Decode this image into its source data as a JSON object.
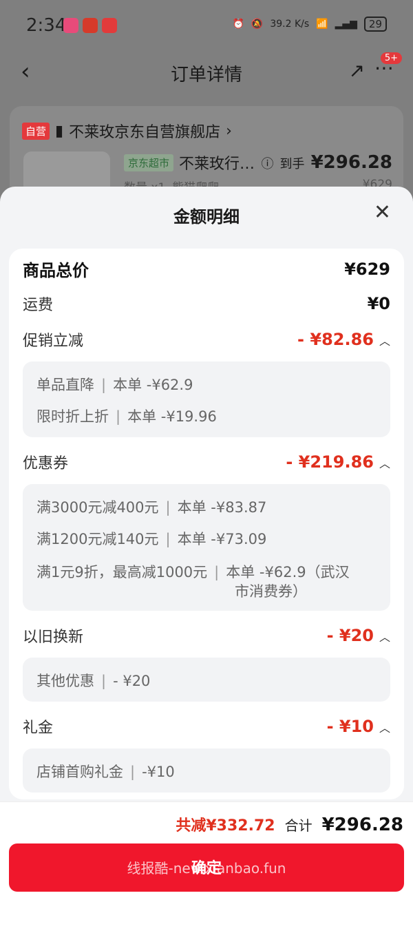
{
  "status_bar": {
    "time": "2:34",
    "network_speed": "39.2 K/s",
    "battery": "29"
  },
  "nav": {
    "title": "订单详情",
    "badge": "5+"
  },
  "background_order": {
    "self_tag": "自营",
    "store_name": "不莱玫京东自营旗舰店",
    "market_tag": "京东超市",
    "product_name": "不莱玫行…",
    "arrival_label": "到手",
    "arrival_price": "¥296.28",
    "quantity": "数量 x1",
    "spec": "熊猫爬爬",
    "original_price": "¥629"
  },
  "sheet": {
    "title": "金额明细",
    "goods_total": {
      "label": "商品总价",
      "value": "¥629"
    },
    "shipping": {
      "label": "运费",
      "value": "¥0"
    },
    "promo": {
      "label": "促销立减",
      "value": "- ¥82.86",
      "items": [
        {
          "name": "单品直降",
          "detail": "本单 -¥62.9"
        },
        {
          "name": "限时折上折",
          "detail": "本单 -¥19.96"
        }
      ]
    },
    "coupon": {
      "label": "优惠券",
      "value": "- ¥219.86",
      "items": [
        {
          "name": "满3000元减400元",
          "detail": "本单 -¥83.87"
        },
        {
          "name": "满1200元减140元",
          "detail": "本单 -¥73.09"
        },
        {
          "name": "满1元9折，最高减1000元",
          "detail": "本单 -¥62.9（武汉",
          "detail2": "市消费券）"
        }
      ]
    },
    "tradein": {
      "label": "以旧换新",
      "value": "- ¥20",
      "items": [
        {
          "name": "其他优惠",
          "detail": "- ¥20"
        }
      ]
    },
    "gift": {
      "label": "礼金",
      "value": "- ¥10",
      "items": [
        {
          "name": "店铺首购礼金",
          "detail": "-¥10"
        }
      ]
    }
  },
  "footer": {
    "total_discount": "共减¥332.72",
    "total_label": "合计",
    "total_value": "¥296.28",
    "confirm_label": "确定",
    "watermark": "线报酷-new.xianbao.fun"
  }
}
